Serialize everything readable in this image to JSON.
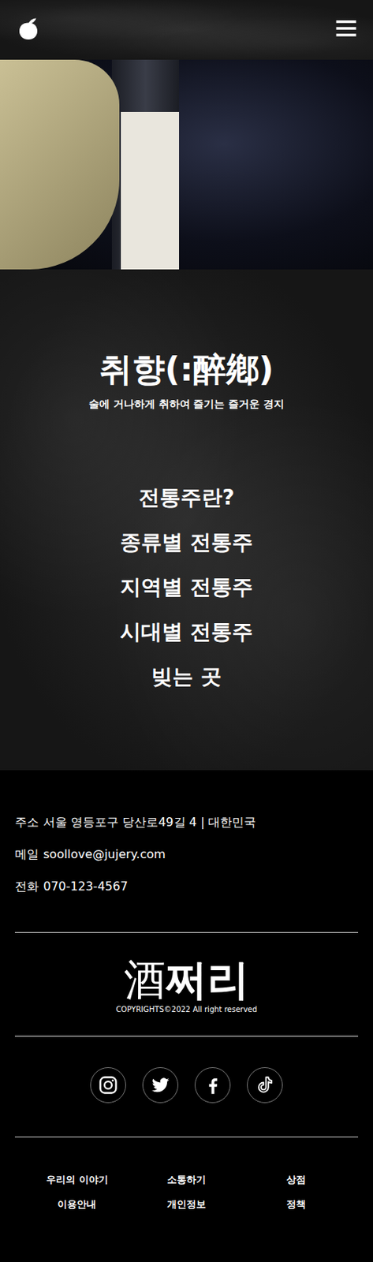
{
  "hero": {
    "title": "취향(:醉鄕)",
    "subtitle": "술에 거나하게 취하여 즐기는 즐거운 경지"
  },
  "nav": [
    "전통주란?",
    "종류별 전통주",
    "지역별 전통주",
    "시대별 전통주",
    "빚는 곳"
  ],
  "contact": [
    {
      "label": "주소",
      "value": "서울 영등포구 당산로49길 4 | 대한민국"
    },
    {
      "label": "메일",
      "value": "soollove@jujery.com"
    },
    {
      "label": "전화",
      "value": "070-123-4567"
    }
  ],
  "brand": {
    "hanja": "酒",
    "hangul": "쩌리",
    "copyright": "COPYRIGHTS©2022 All right reserved"
  },
  "footer_links": [
    "우리의 이야기",
    "소통하기",
    "상점",
    "이용안내",
    "개인정보",
    "정책"
  ]
}
